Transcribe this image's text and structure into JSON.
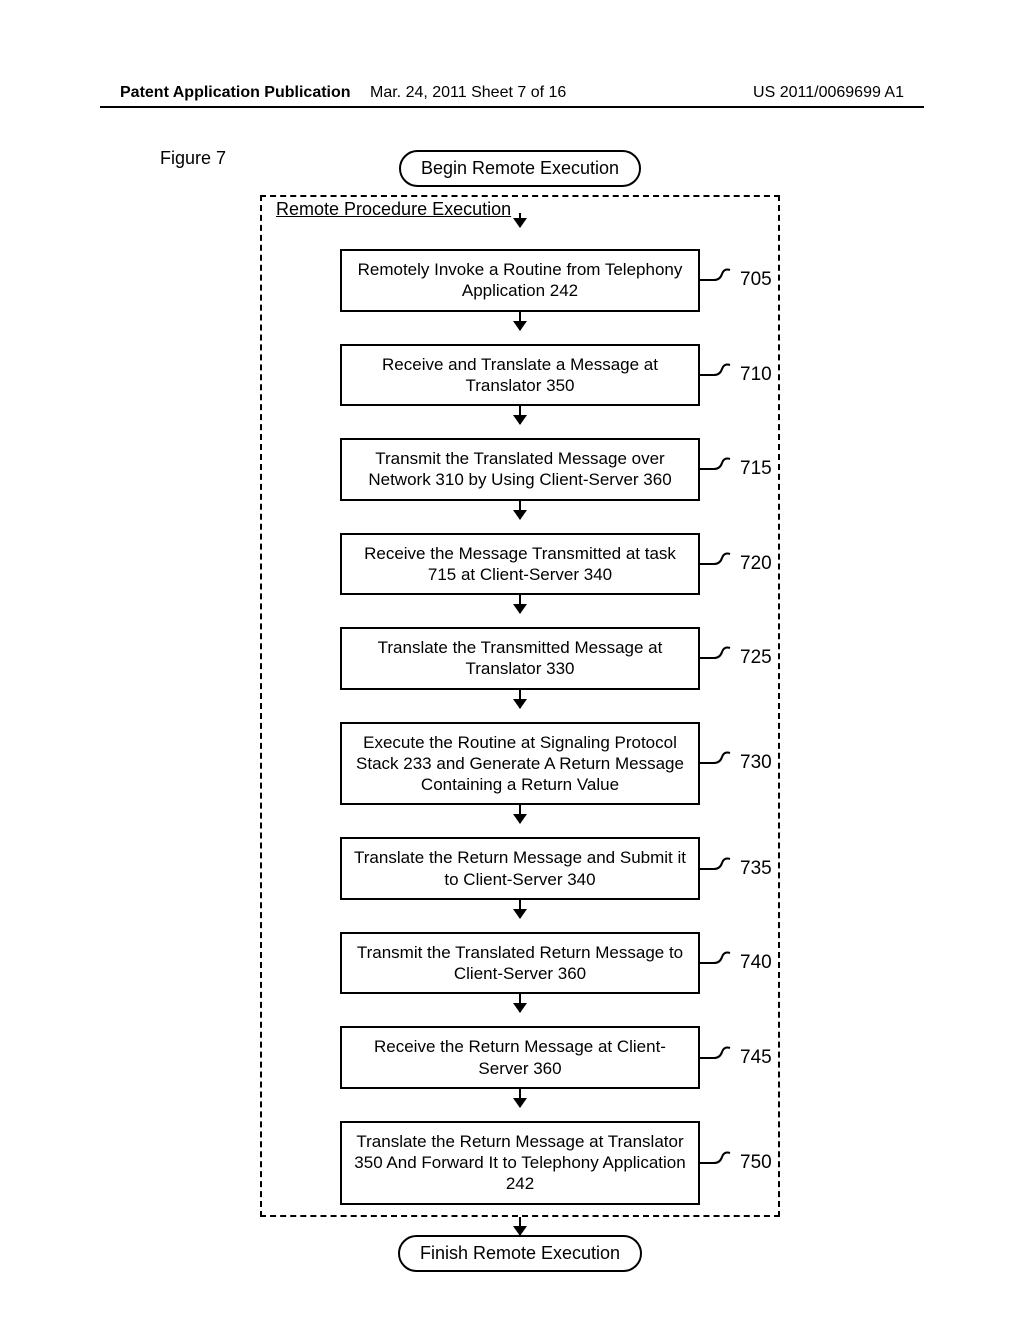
{
  "header": {
    "left": "Patent Application Publication",
    "mid": "Mar. 24, 2011  Sheet 7 of 16",
    "right": "US 2011/0069699 A1"
  },
  "figure_label": "Figure 7",
  "terminator_begin": "Begin Remote Execution",
  "terminator_end": "Finish Remote Execution",
  "group_title": "Remote Procedure Execution",
  "steps": [
    {
      "ref": "705",
      "text": "Remotely Invoke a Routine from Telephony Application 242"
    },
    {
      "ref": "710",
      "text": "Receive and Translate a Message at Translator 350"
    },
    {
      "ref": "715",
      "text": "Transmit the Translated Message over Network 310 by Using Client-Server 360"
    },
    {
      "ref": "720",
      "text": "Receive the Message Transmitted at task 715 at Client-Server 340"
    },
    {
      "ref": "725",
      "text": "Translate the Transmitted Message at Translator 330"
    },
    {
      "ref": "730",
      "text": "Execute the Routine at Signaling Protocol Stack 233 and Generate A Return Message Containing a Return Value"
    },
    {
      "ref": "735",
      "text": "Translate the Return Message and Submit it to Client-Server 340"
    },
    {
      "ref": "740",
      "text": "Transmit the Translated Return Message to Client-Server 360"
    },
    {
      "ref": "745",
      "text": "Receive the Return Message at Client-Server 360"
    },
    {
      "ref": "750",
      "text": "Translate the Return Message at Translator 350 And Forward It to Telephony Application 242"
    }
  ]
}
